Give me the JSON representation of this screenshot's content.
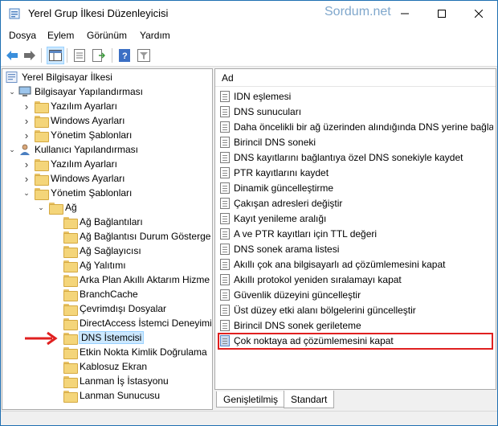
{
  "window": {
    "title": "Yerel Grup İlkesi Düzenleyicisi",
    "watermark": "Sordum.net"
  },
  "menu": {
    "items": [
      "Dosya",
      "Eylem",
      "Görünüm",
      "Yardım"
    ]
  },
  "tree": {
    "nodes": [
      {
        "label": "Yerel Bilgisayar İlkesi",
        "level": 0,
        "icon": "computer-policy-icon",
        "expander": ""
      },
      {
        "label": "Bilgisayar Yapılandırması",
        "level": 1,
        "icon": "computer-icon",
        "expander": "expanded"
      },
      {
        "label": "Yazılım Ayarları",
        "level": 2,
        "icon": "folder-icon",
        "expander": "collapsed"
      },
      {
        "label": "Windows Ayarları",
        "level": 2,
        "icon": "folder-icon",
        "expander": "collapsed"
      },
      {
        "label": "Yönetim Şablonları",
        "level": 2,
        "icon": "folder-icon",
        "expander": "collapsed"
      },
      {
        "label": "Kullanıcı Yapılandırması",
        "level": 1,
        "icon": "user-icon",
        "expander": "expanded"
      },
      {
        "label": "Yazılım Ayarları",
        "level": 2,
        "icon": "folder-icon",
        "expander": "collapsed"
      },
      {
        "label": "Windows Ayarları",
        "level": 2,
        "icon": "folder-icon",
        "expander": "collapsed"
      },
      {
        "label": "Yönetim Şablonları",
        "level": 2,
        "icon": "folder-icon",
        "expander": "expanded"
      },
      {
        "label": "Ağ",
        "level": 3,
        "icon": "folder-icon",
        "expander": "expanded"
      },
      {
        "label": "Ağ Bağlantıları",
        "level": 4,
        "icon": "folder-icon",
        "expander": ""
      },
      {
        "label": "Ağ Bağlantısı Durum Gösterge",
        "level": 4,
        "icon": "folder-icon",
        "expander": ""
      },
      {
        "label": "Ağ Sağlayıcısı",
        "level": 4,
        "icon": "folder-icon",
        "expander": ""
      },
      {
        "label": "Ağ Yalıtımı",
        "level": 4,
        "icon": "folder-icon",
        "expander": ""
      },
      {
        "label": "Arka Plan Akıllı Aktarım Hizme",
        "level": 4,
        "icon": "folder-icon",
        "expander": ""
      },
      {
        "label": "BranchCache",
        "level": 4,
        "icon": "folder-icon",
        "expander": ""
      },
      {
        "label": "Çevrimdışı Dosyalar",
        "level": 4,
        "icon": "folder-icon",
        "expander": ""
      },
      {
        "label": "DirectAccess İstemci Deneyimi",
        "level": 4,
        "icon": "folder-icon",
        "expander": ""
      },
      {
        "label": "DNS İstemcisi",
        "level": 4,
        "icon": "folder-icon",
        "expander": "",
        "selected": true
      },
      {
        "label": "Etkin Nokta Kimlik Doğrulama",
        "level": 4,
        "icon": "folder-icon",
        "expander": ""
      },
      {
        "label": "Kablosuz Ekran",
        "level": 4,
        "icon": "folder-icon",
        "expander": ""
      },
      {
        "label": "Lanman İş İstasyonu",
        "level": 4,
        "icon": "folder-icon",
        "expander": ""
      },
      {
        "label": "Lanman Sunucusu",
        "level": 4,
        "icon": "folder-icon",
        "expander": ""
      }
    ]
  },
  "list": {
    "column_header": "Ad",
    "items": [
      "IDN eşlemesi",
      "DNS sunucuları",
      "Daha öncelikli bir ağ üzerinden alındığında DNS yerine bağla…",
      "Birincil DNS soneki",
      "DNS kayıtlarını bağlantıya özel DNS sonekiyle kaydet",
      "PTR kayıtlarını kaydet",
      "Dinamik güncelleştirme",
      "Çakışan adresleri değiştir",
      "Kayıt yenileme aralığı",
      "A ve PTR kayıtları için TTL değeri",
      "DNS sonek arama listesi",
      "Akıllı çok ana bilgisayarlı ad çözümlemesini kapat",
      "Akıllı protokol yeniden sıralamayı kapat",
      "Güvenlik düzeyini güncelleştir",
      "Üst düzey etki alanı bölgelerini güncelleştir",
      "Birincil DNS sonek gerileteme",
      "Çok noktaya ad çözümlemesini kapat"
    ],
    "highlighted_index": 16
  },
  "tabs": {
    "items": [
      "Genişletilmiş",
      "Standart"
    ],
    "active": "Standart"
  },
  "colors": {
    "highlight_border": "#e02020",
    "arrow": "#e02020",
    "selection": "#cce8ff"
  }
}
